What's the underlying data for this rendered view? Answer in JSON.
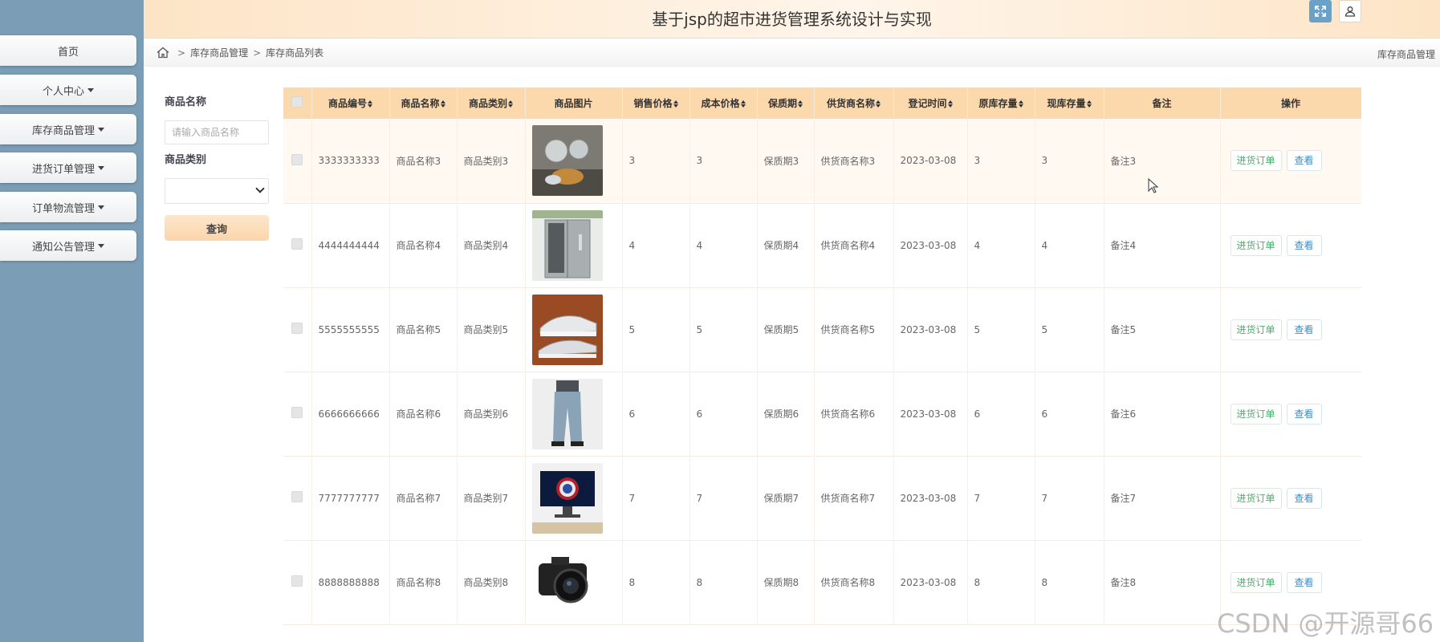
{
  "app": {
    "title": "基于jsp的超市进货管理系统设计与实现"
  },
  "sidebar": {
    "items": [
      {
        "label": "首页",
        "has_caret": false
      },
      {
        "label": "个人中心",
        "has_caret": true
      },
      {
        "label": "库存商品管理",
        "has_caret": true
      },
      {
        "label": "进货订单管理",
        "has_caret": true
      },
      {
        "label": "订单物流管理",
        "has_caret": true
      },
      {
        "label": "通知公告管理",
        "has_caret": true
      }
    ]
  },
  "header": {
    "expand_icon": "fullscreen-icon",
    "user_icon": "user-icon"
  },
  "breadcrumb": {
    "home_icon": "home-icon",
    "items": [
      "库存商品管理",
      "库存商品列表"
    ],
    "right": "库存商品管理"
  },
  "search": {
    "name_label": "商品名称",
    "name_placeholder": "请输入商品名称",
    "name_value": "",
    "category_label": "商品类别",
    "category_value": "",
    "submit_label": "查询"
  },
  "table": {
    "columns": [
      "商品编号",
      "商品名称",
      "商品类别",
      "商品图片",
      "销售价格",
      "成本价格",
      "保质期",
      "供货商名称",
      "登记时间",
      "原库存量",
      "现库存量",
      "备注",
      "操作"
    ],
    "order_label": "进货订单",
    "view_label": "查看",
    "rows": [
      {
        "code": "3333333333",
        "name": "商品名称3",
        "category": "商品类别3",
        "image": "glasses-bowls",
        "sale_price": "3",
        "cost_price": "3",
        "shelf_life": "保质期3",
        "supplier": "供货商名称3",
        "date": "2023-03-08",
        "orig_stock": "3",
        "curr_stock": "3",
        "note": "备注3"
      },
      {
        "code": "4444444444",
        "name": "商品名称4",
        "category": "商品类别4",
        "image": "refrigerator",
        "sale_price": "4",
        "cost_price": "4",
        "shelf_life": "保质期4",
        "supplier": "供货商名称4",
        "date": "2023-03-08",
        "orig_stock": "4",
        "curr_stock": "4",
        "note": "备注4"
      },
      {
        "code": "5555555555",
        "name": "商品名称5",
        "category": "商品类别5",
        "image": "sneakers",
        "sale_price": "5",
        "cost_price": "5",
        "shelf_life": "保质期5",
        "supplier": "供货商名称5",
        "date": "2023-03-08",
        "orig_stock": "5",
        "curr_stock": "5",
        "note": "备注5"
      },
      {
        "code": "6666666666",
        "name": "商品名称6",
        "category": "商品类别6",
        "image": "jeans",
        "sale_price": "6",
        "cost_price": "6",
        "shelf_life": "保质期6",
        "supplier": "供货商名称6",
        "date": "2023-03-08",
        "orig_stock": "6",
        "curr_stock": "6",
        "note": "备注6"
      },
      {
        "code": "7777777777",
        "name": "商品名称7",
        "category": "商品类别7",
        "image": "monitor",
        "sale_price": "7",
        "cost_price": "7",
        "shelf_life": "保质期7",
        "supplier": "供货商名称7",
        "date": "2023-03-08",
        "orig_stock": "7",
        "curr_stock": "7",
        "note": "备注7"
      },
      {
        "code": "8888888888",
        "name": "商品名称8",
        "category": "商品类别8",
        "image": "camera",
        "sale_price": "8",
        "cost_price": "8",
        "shelf_life": "保质期8",
        "supplier": "供货商名称8",
        "date": "2023-03-08",
        "orig_stock": "8",
        "curr_stock": "8",
        "note": "备注8"
      }
    ]
  },
  "watermark": "CSDN @开源哥66",
  "colors": {
    "sidebar_bg": "#7b9db5",
    "header_bg": "#fde4c6",
    "table_header_bg": "#fcd9ad",
    "order_btn": "#4fae6f",
    "view_btn": "#3d8cc9"
  }
}
